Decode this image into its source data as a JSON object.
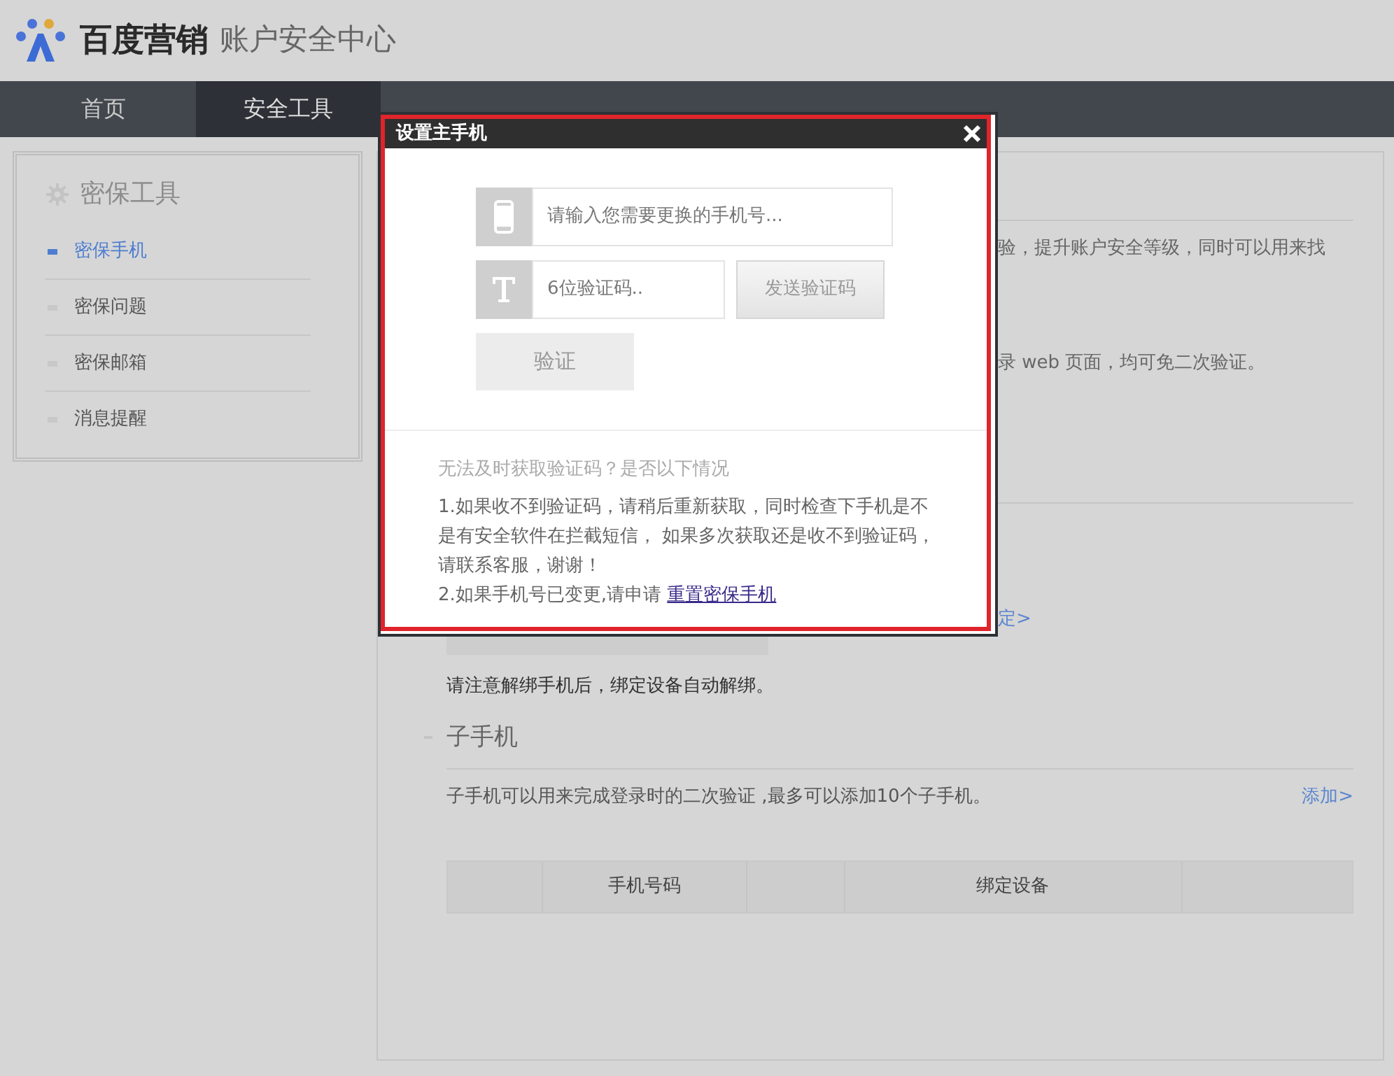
{
  "header": {
    "brand": "百度营销",
    "subtitle": "账户安全中心"
  },
  "nav": [
    {
      "label": "首页",
      "selected": false
    },
    {
      "label": "安全工具",
      "selected": true
    }
  ],
  "sidebar": {
    "title": "密保工具",
    "items": [
      {
        "label": "密保手机",
        "selected": true
      },
      {
        "label": "密保问题",
        "selected": false
      },
      {
        "label": "密保邮箱",
        "selected": false
      },
      {
        "label": "消息提醒",
        "selected": false
      }
    ]
  },
  "main": {
    "fragments": [
      "验，提升账户安全等级，同时可以用来找",
      "录 web 页面，均可免二次验证。"
    ],
    "link_fragment": "定>",
    "notice": "请注意解绑手机后，绑定设备自动解绑。",
    "sub_section": {
      "title": "子手机",
      "description": "子手机可以用来完成登录时的二次验证 ,最多可以添加10个子手机。",
      "add_link": "添加>",
      "columns": [
        {
          "kind": "blank"
        },
        {
          "kind": "text",
          "label": "手机号码"
        },
        {
          "kind": "blank"
        },
        {
          "kind": "text",
          "label": "绑定设备"
        },
        {
          "kind": "blank"
        }
      ]
    }
  },
  "modal": {
    "title": "设置主手机",
    "phone_field": {
      "placeholder": "请输入您需要更换的手机号..."
    },
    "code_field": {
      "placeholder": "6位验证码.."
    },
    "send_button": {
      "label": "发送验证码",
      "disabled": true
    },
    "verify_button": {
      "label": "验证",
      "disabled": true
    },
    "help": {
      "title": "无法及时获取验证码？是否以下情况",
      "item_1": "1.如果收不到验证码，请稍后重新获取，同时检查下手机是不是有安全软件在拦截短信， 如果多次获取还是收不到验证码，请联系客服，谢谢！",
      "item_2": "2.如果手机号已变更,请申请 ",
      "item_2_link": "重置密保手机"
    }
  }
}
